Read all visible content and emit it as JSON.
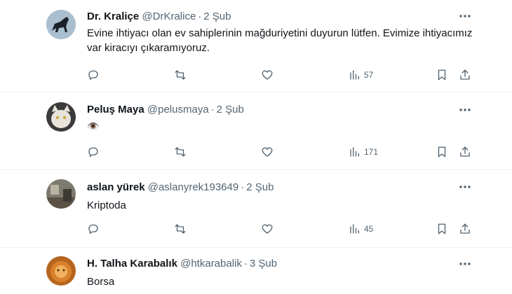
{
  "tweets": [
    {
      "name": "Dr. Kraliçe",
      "handle": "@DrKralice",
      "separator": "·",
      "time": "2 Şub",
      "text": "Evine ihtiyacı olan ev sahiplerinin mağduriyetini duyurun lütfen. Evimize ihtiyacımız var kiracıyı çıkaramıyoruz.",
      "views": "57",
      "avatar": "horse-avatar"
    },
    {
      "name": "Peluş Maya",
      "handle": "@pelusmaya",
      "separator": "·",
      "time": "2 Şub",
      "text": "👁️",
      "views": "171",
      "avatar": "cat-avatar"
    },
    {
      "name": "aslan yürek",
      "handle": "@aslanyrek193649",
      "separator": "·",
      "time": "2 Şub",
      "text": "Kriptoda",
      "views": "45",
      "avatar": "room-avatar"
    },
    {
      "name": "H. Talha Karabalık",
      "handle": "@htkarabalik",
      "separator": "·",
      "time": "3 Şub",
      "text": "Borsa",
      "avatar": "lion-avatar"
    }
  ],
  "icons": {
    "reply": "reply-icon",
    "retweet": "retweet-icon",
    "like": "like-icon",
    "views": "views-icon",
    "bookmark": "bookmark-icon",
    "share": "share-icon",
    "more": "more-icon"
  },
  "colors": {
    "text_primary": "#0f1419",
    "text_secondary": "#536471",
    "divider": "#eff3f4"
  }
}
